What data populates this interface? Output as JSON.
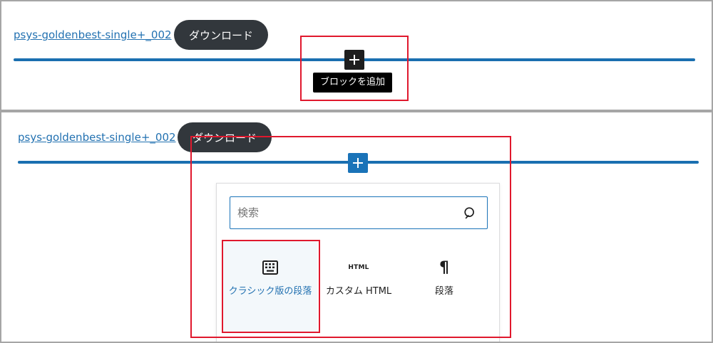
{
  "top_panel": {
    "file_link": "psys-goldenbest-single+_002",
    "download_button": "ダウンロード",
    "add_block_tooltip": "ブロックを追加"
  },
  "bottom_panel": {
    "file_link": "psys-goldenbest-single+_002",
    "download_button": "ダウンロード",
    "inserter": {
      "search_placeholder": "検索",
      "blocks": [
        {
          "label": "クラシック版の段落",
          "icon": "classic-block-icon",
          "selected": true
        },
        {
          "label": "カスタム HTML",
          "icon": "html-icon",
          "icon_text": "HTML"
        },
        {
          "label": "段落",
          "icon": "paragraph-icon",
          "icon_text": "¶"
        }
      ]
    }
  },
  "colors": {
    "link": "#2271b1",
    "button_dark": "#32373c",
    "separator_blue": "#1a6fb0",
    "highlight_red": "#e0182d"
  }
}
